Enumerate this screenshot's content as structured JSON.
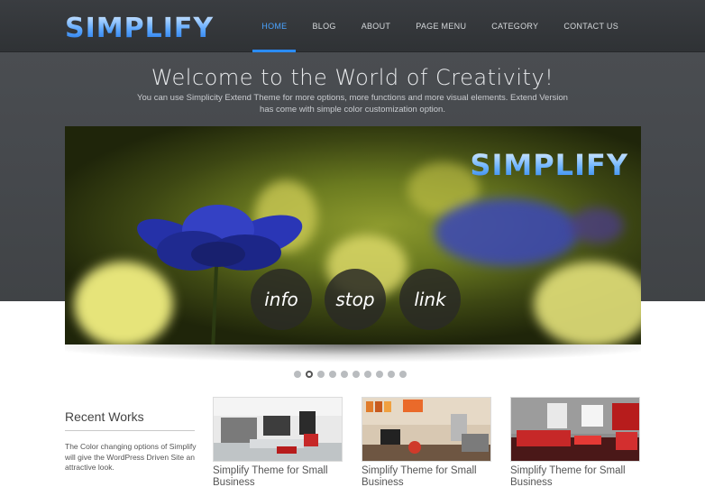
{
  "header": {
    "logo_text": "SIMPLIFY",
    "nav": [
      "HOME",
      "BLOG",
      "ABOUT",
      "PAGE MENU",
      "CATEGORY",
      "CONTACT US"
    ]
  },
  "hero": {
    "title": "Welcome to the World of Creativity!",
    "subtitle": "You can use Simplicity Extend Theme for more options, more functions and more visual elements. Extend Version has come with simple color customization option."
  },
  "slider": {
    "logo_text": "SIMPLIFY",
    "buttons": [
      "info",
      "stop",
      "link"
    ],
    "dot_count": 10,
    "active_dot": 2
  },
  "recent": {
    "title": "Recent Works",
    "text": "The Color changing options of Simplify will give the WordPress Driven Site an attractive look.",
    "items": [
      {
        "title": "Simplify Theme for Small Business"
      },
      {
        "title": "Simplify Theme for Small Business"
      },
      {
        "title": "Simplify Theme for Small Business"
      }
    ]
  },
  "colors": {
    "accent": "#2a8cff",
    "nav_bg": "#33363a",
    "band_bg": "#46494d"
  }
}
